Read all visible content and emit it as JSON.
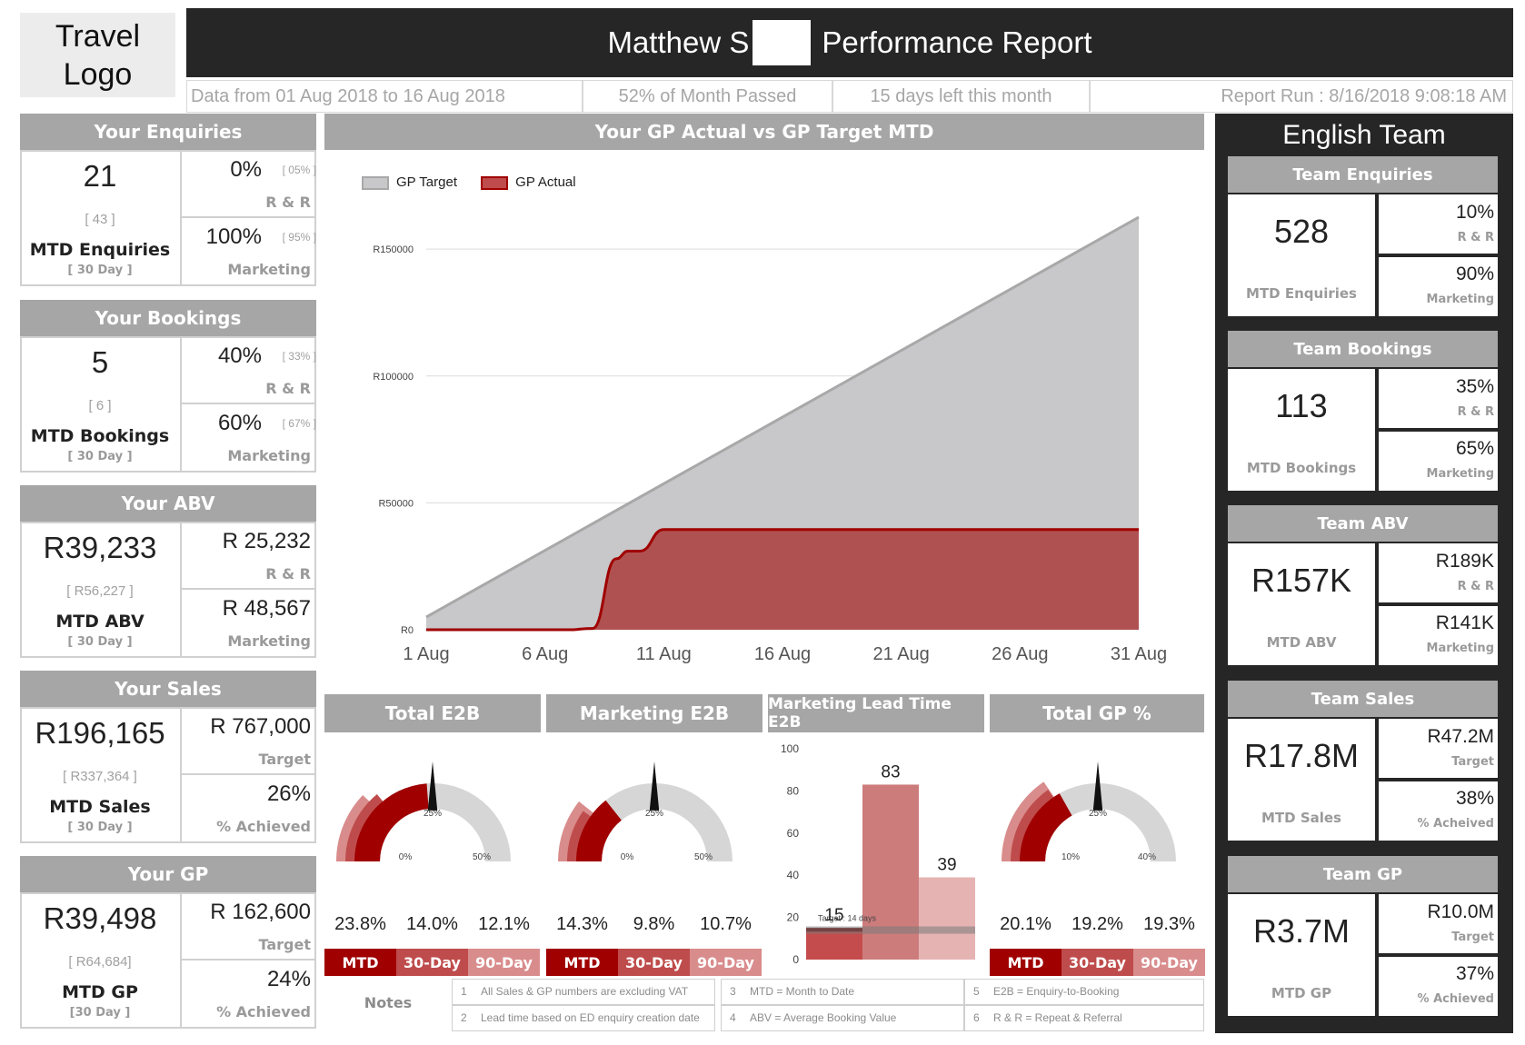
{
  "logo": {
    "line1": "Travel",
    "line2": "Logo"
  },
  "header": {
    "title_left": "Matthew S",
    "title_right": "Performance Report"
  },
  "info": {
    "data_range": "Data from 01 Aug 2018 to 16 Aug 2018",
    "month_passed": "52% of Month Passed",
    "days_left": "15 days left this month",
    "report_run": "Report Run : 8/16/2018 9:08:18 AM"
  },
  "left_cards": [
    {
      "title": "Your Enquiries",
      "main": "21",
      "bracket": "[ 43 ]",
      "label": "MTD Enquiries",
      "sub": "[ 30 Day ]",
      "r1_val": "0%",
      "r1_br": "[ 05% ]",
      "r1_lbl": "R & R",
      "r2_val": "100%",
      "r2_br": "[ 95% ]",
      "r2_lbl": "Marketing"
    },
    {
      "title": "Your Bookings",
      "main": "5",
      "bracket": "[ 6 ]",
      "label": "MTD Bookings",
      "sub": "[ 30 Day ]",
      "r1_val": "40%",
      "r1_br": "[ 33% ]",
      "r1_lbl": "R & R",
      "r2_val": "60%",
      "r2_br": "[ 67% ]",
      "r2_lbl": "Marketing"
    },
    {
      "title": "Your ABV",
      "main": "R39,233",
      "bracket": "[ R56,227 ]",
      "label": "MTD ABV",
      "sub": "[ 30 Day ]",
      "r1_val": "R 25,232",
      "r1_br": "",
      "r1_lbl": "R & R",
      "r2_val": "R 48,567",
      "r2_br": "",
      "r2_lbl": "Marketing"
    },
    {
      "title": "Your Sales",
      "main": "R196,165",
      "bracket": "[ R337,364 ]",
      "label": "MTD Sales",
      "sub": "[ 30 Day ]",
      "r1_val": "R 767,000",
      "r1_br": "",
      "r1_lbl": "Target",
      "r2_val": "26%",
      "r2_br": "",
      "r2_lbl": "% Achieved"
    },
    {
      "title": "Your GP",
      "main": "R39,498",
      "bracket": "[ R64,684]",
      "label": "MTD GP",
      "sub": "[30 Day ]",
      "r1_val": "R 162,600",
      "r1_br": "",
      "r1_lbl": "Target",
      "r2_val": "24%",
      "r2_br": "",
      "r2_lbl": "% Achieved"
    }
  ],
  "team": {
    "title": "English Team",
    "cards": [
      {
        "title": "Team Enquiries",
        "main": "528",
        "label": "MTD Enquiries",
        "r1_val": "10%",
        "r1_lbl": "R & R",
        "r2_val": "90%",
        "r2_lbl": "Marketing"
      },
      {
        "title": "Team Bookings",
        "main": "113",
        "label": "MTD Bookings",
        "r1_val": "35%",
        "r1_lbl": "R & R",
        "r2_val": "65%",
        "r2_lbl": "Marketing"
      },
      {
        "title": "Team ABV",
        "main": "R157K",
        "label": "MTD ABV",
        "r1_val": "R189K",
        "r1_lbl": "R & R",
        "r2_val": "R141K",
        "r2_lbl": "Marketing"
      },
      {
        "title": "Team Sales",
        "main": "R17.8M",
        "label": "MTD Sales",
        "r1_val": "R47.2M",
        "r1_lbl": "Target",
        "r2_val": "38%",
        "r2_lbl": "% Acheived"
      },
      {
        "title": "Team GP",
        "main": "R3.7M",
        "label": "MTD GP",
        "r1_val": "R10.0M",
        "r1_lbl": "Target",
        "r2_val": "37%",
        "r2_lbl": "% Achieved"
      }
    ]
  },
  "colors": {
    "accent_dark": "#a00000",
    "accent_mid": "#bf4c4c",
    "accent_light": "#d98c8c",
    "header_grey": "#a6a6a6",
    "banner": "#262626"
  },
  "chart_data": [
    {
      "type": "area",
      "title": "Your GP Actual vs GP Target MTD",
      "legend": [
        "GP Target",
        "GP Actual"
      ],
      "legend_position": "top-left",
      "x_ticks": [
        "1 Aug",
        "6 Aug",
        "11 Aug",
        "16 Aug",
        "21 Aug",
        "26 Aug",
        "31 Aug"
      ],
      "y_ticks": [
        "R0",
        "R50000",
        "R100000",
        "R150000"
      ],
      "ylim": [
        0,
        162600
      ],
      "x": [
        1,
        31
      ],
      "series": [
        {
          "name": "GP Target",
          "x": [
            1,
            31
          ],
          "values": [
            5000,
            162600
          ]
        },
        {
          "name": "GP Actual",
          "x": [
            1,
            5,
            6,
            7,
            8,
            9,
            9.5,
            10,
            11,
            31
          ],
          "values": [
            0,
            0,
            0,
            0,
            500,
            28000,
            31000,
            31000,
            39498,
            39498
          ]
        }
      ]
    },
    {
      "type": "gauge",
      "title": "Total E2B",
      "ticks": [
        "0%",
        "25%",
        "50%"
      ],
      "target": 25,
      "categories": [
        "MTD",
        "30-Day",
        "90-Day"
      ],
      "values": [
        23.8,
        14.0,
        12.1
      ],
      "value_labels": [
        "23.8%",
        "14.0%",
        "12.1%"
      ]
    },
    {
      "type": "gauge",
      "title": "Marketing E2B",
      "ticks": [
        "0%",
        "25%",
        "50%"
      ],
      "target": 25,
      "categories": [
        "MTD",
        "30-Day",
        "90-Day"
      ],
      "values": [
        14.3,
        9.8,
        10.7
      ],
      "value_labels": [
        "14.3%",
        "9.8%",
        "10.7%"
      ]
    },
    {
      "type": "bar",
      "title": "Marketing Lead Time E2B",
      "y_ticks": [
        "0",
        "20",
        "40",
        "60",
        "80",
        "100"
      ],
      "ylim": [
        0,
        100
      ],
      "categories": [
        "MTD",
        "30-Day",
        "90-Day"
      ],
      "values": [
        15,
        83,
        39
      ],
      "target_label": "Target : 14 days",
      "target": 14
    },
    {
      "type": "gauge",
      "title": "Total GP %",
      "ticks": [
        "10%",
        "25%",
        "40%"
      ],
      "target": 25,
      "categories": [
        "MTD",
        "30-Day",
        "90-Day"
      ],
      "values": [
        20.1,
        19.2,
        19.3
      ],
      "value_labels": [
        "20.1%",
        "19.2%",
        "19.3%"
      ]
    }
  ],
  "legend_bar": [
    "MTD",
    "30-Day",
    "90-Day"
  ],
  "notes": {
    "title": "Notes",
    "items": [
      {
        "n": "1",
        "text": "All Sales & GP numbers are excluding VAT"
      },
      {
        "n": "2",
        "text": "Lead time based on ED enquiry creation date"
      },
      {
        "n": "3",
        "text": "MTD = Month to Date"
      },
      {
        "n": "4",
        "text": "ABV = Average Booking Value"
      },
      {
        "n": "5",
        "text": "E2B = Enquiry-to-Booking"
      },
      {
        "n": "6",
        "text": "R & R = Repeat & Referral"
      }
    ]
  }
}
